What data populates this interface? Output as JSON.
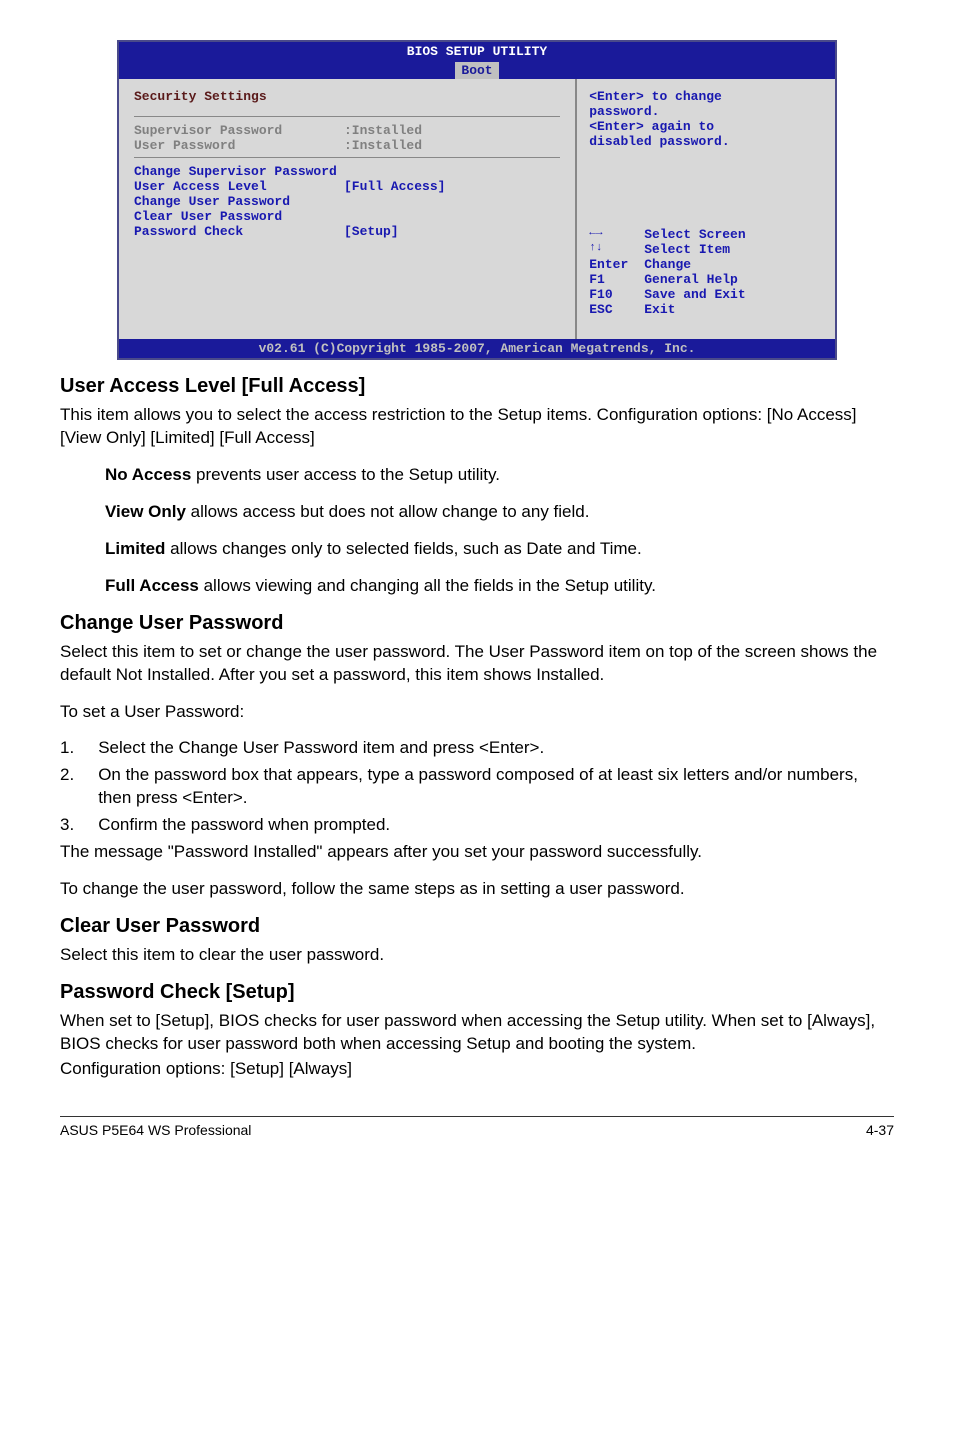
{
  "bios": {
    "title": "BIOS SETUP UTILITY",
    "tab": "Boot",
    "section_title": "Security Settings",
    "rows": {
      "supervisor_label": "Supervisor Password",
      "supervisor_value": ":Installed",
      "user_label": "User Password",
      "user_value": ":Installed",
      "change_super": "Change Supervisor Password",
      "access_level_label": "User Access Level",
      "access_level_value": "[Full Access]",
      "change_user": "Change User Password",
      "clear_user": "Clear User Password",
      "pw_check_label": "Password Check",
      "pw_check_value": "[Setup]"
    },
    "help": {
      "line1": "<Enter> to change",
      "line2": "password.",
      "line3": "<Enter> again to",
      "line4": "disabled password."
    },
    "keys": {
      "lr_icon": "←→",
      "lr_label": "Select Screen",
      "ud_icon": "↑↓",
      "ud_label": "Select Item",
      "enter_key": "Enter",
      "enter_label": "Change",
      "f1_key": "F1",
      "f1_label": "General Help",
      "f10_key": "F10",
      "f10_label": "Save and Exit",
      "esc_key": "ESC",
      "esc_label": "Exit"
    },
    "footer": "v02.61 (C)Copyright 1985-2007, American Megatrends, Inc."
  },
  "doc": {
    "h_ual": "User Access Level [Full Access]",
    "p_ual1": "This item allows you to select the access restriction to the Setup items. Configuration options: [No Access] [View Only] [Limited] [Full Access]",
    "na_bold": "No Access",
    "na_text": " prevents user access to the Setup utility.",
    "vo_bold": "View Only",
    "vo_text": " allows access but does not allow change to any field.",
    "lim_bold": "Limited",
    "lim_text": " allows changes only to selected fields, such as Date and Time.",
    "fa_bold": "Full Access",
    "fa_text": " allows viewing and changing all the fields in the Setup utility.",
    "h_cup": "Change User Password",
    "p_cup1": "Select this item to set or change the user password. The User Password item on top of the screen shows the default Not Installed. After you set a password, this item shows Installed.",
    "p_cup2": "To set a User Password:",
    "li1": "Select the Change User Password item and press <Enter>.",
    "li2": "On the password box that appears, type a password composed of at least six letters and/or numbers, then press <Enter>.",
    "li3": "Confirm the password when prompted.",
    "p_cup3": "The message \"Password Installed\" appears after you set your password successfully.",
    "p_cup4": "To change the user password, follow the same steps as in setting a user password.",
    "h_clp": "Clear User Password",
    "p_clp1": "Select this item to clear the user password.",
    "h_pcs": "Password Check [Setup]",
    "p_pcs1": "When set to [Setup], BIOS checks for user password when accessing the Setup utility. When set to [Always], BIOS checks for user password both when accessing Setup and booting the system.",
    "p_pcs2": "Configuration options: [Setup] [Always]",
    "footer_left": "ASUS P5E64 WS Professional",
    "footer_right": "4-37"
  }
}
